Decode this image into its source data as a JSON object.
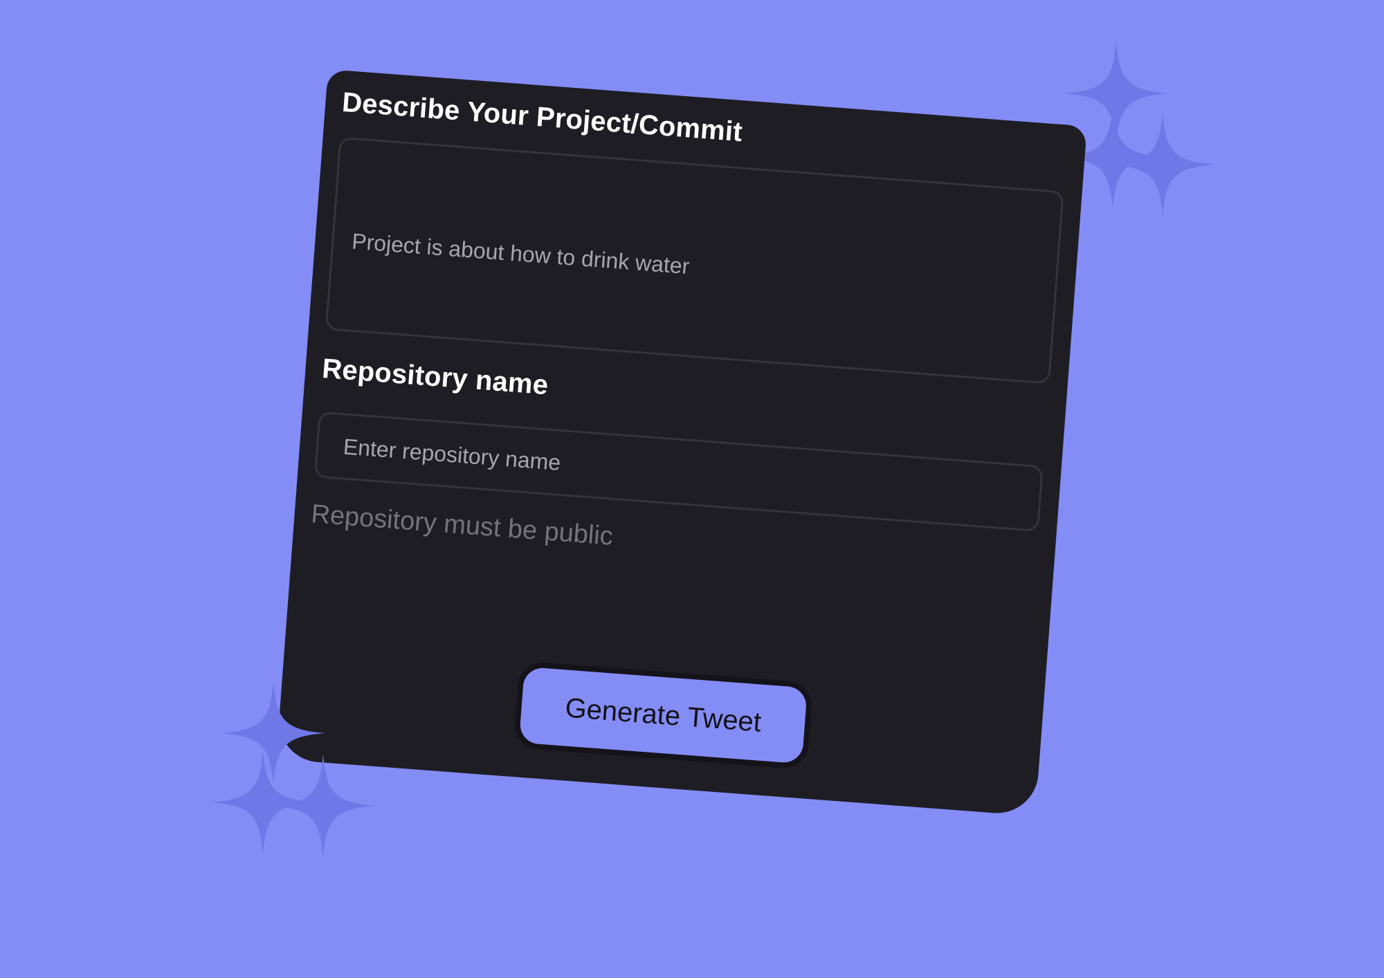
{
  "form": {
    "description_title": "Describe Your Project/Commit",
    "description_placeholder": "Project is about how to drink water",
    "repository_title": "Repository name",
    "repository_placeholder": "Enter repository name",
    "repository_hint": "Repository must be public",
    "generate_label": "Generate Tweet"
  },
  "colors": {
    "background": "#848cf6",
    "card": "#1e1d24",
    "accent": "#848cf6",
    "sparkle": "#6f78e6"
  },
  "icons": {
    "decoration": "sparkle-icon"
  }
}
